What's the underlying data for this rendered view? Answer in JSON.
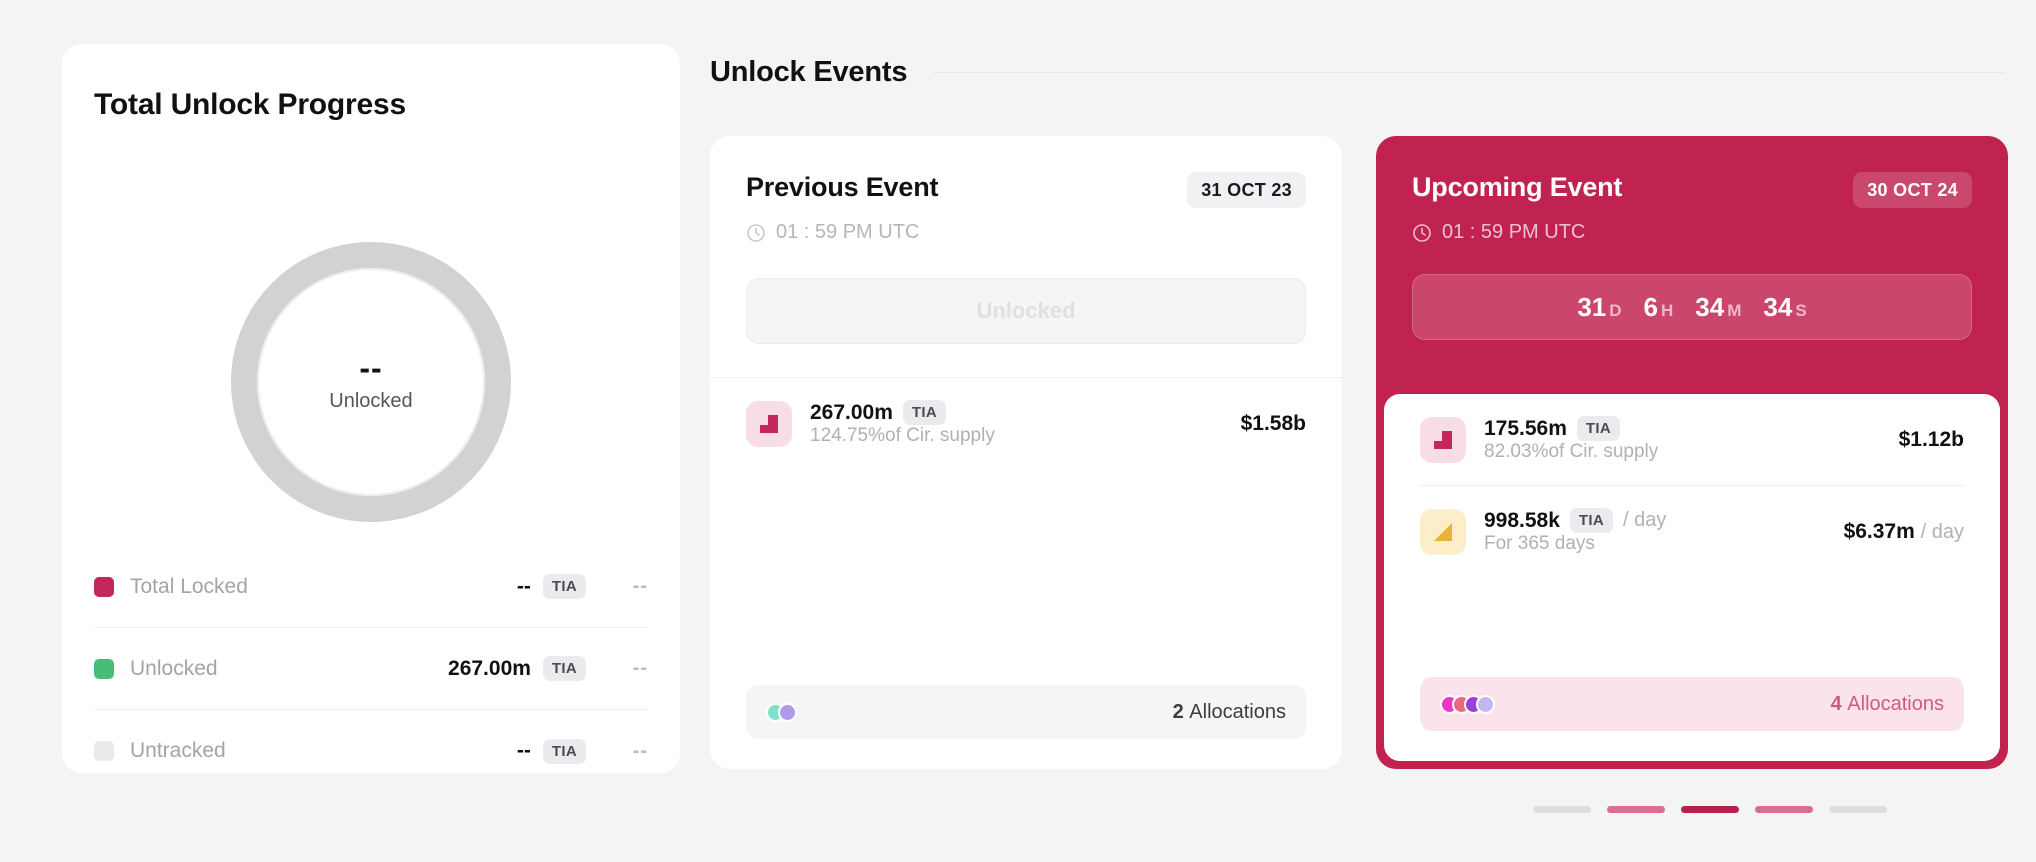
{
  "left_panel": {
    "title": "Total Unlock Progress",
    "donut": {
      "value": "--",
      "label": "Unlocked",
      "track_color": "#d2d2d2"
    },
    "legend": [
      {
        "name": "Total Locked",
        "swatch_color": "#c3275a",
        "amount": "--",
        "ticker": "TIA",
        "percent": "--"
      },
      {
        "name": "Unlocked",
        "swatch_color": "#47bd75",
        "amount": "267.00m",
        "ticker": "TIA",
        "percent": "--"
      },
      {
        "name": "Untracked",
        "swatch_color": "#ebebed",
        "amount": "--",
        "ticker": "TIA",
        "percent": "--"
      }
    ]
  },
  "events": {
    "section_title": "Unlock Events",
    "previous": {
      "title": "Previous Event",
      "date_chip": "31 OCT 23",
      "time": "01 : 59 PM UTC",
      "status_label": "Unlocked",
      "rows": [
        {
          "icon": "cliff-unlock-icon",
          "amount": "267.00m",
          "ticker": "TIA",
          "rate_suffix": "",
          "subtitle": "124.75%of Cir. supply",
          "value": "$1.58b",
          "value_suffix": ""
        }
      ],
      "allocations": {
        "count_number": "2",
        "count_label": "Allocations",
        "dot_colors": [
          "#7fe0c6",
          "#ae9ae8"
        ]
      }
    },
    "upcoming": {
      "title": "Upcoming Event",
      "date_chip": "30 OCT 24",
      "time": "01 : 59 PM UTC",
      "countdown": [
        {
          "value": "31",
          "unit": "D"
        },
        {
          "value": "6",
          "unit": "H"
        },
        {
          "value": "34",
          "unit": "M"
        },
        {
          "value": "34",
          "unit": "S"
        }
      ],
      "rows": [
        {
          "icon": "cliff-unlock-icon",
          "amount": "175.56m",
          "ticker": "TIA",
          "rate_suffix": "",
          "subtitle": "82.03%of Cir. supply",
          "value": "$1.12b",
          "value_suffix": ""
        },
        {
          "icon": "linear-vesting-icon",
          "amount": "998.58k",
          "ticker": "TIA",
          "rate_suffix": "/ day",
          "subtitle": "For 365 days",
          "value": "$6.37m",
          "value_suffix": "/ day"
        }
      ],
      "allocations": {
        "count_number": "4",
        "count_label": "Allocations",
        "dot_colors": [
          "#ec36c7",
          "#e8697f",
          "#9a3fd8",
          "#c3b6ee"
        ]
      },
      "accent_color": "#c0234f"
    }
  },
  "pagination": {
    "bars": [
      "#dedee0",
      "#d96f8f",
      "#b81f4b",
      "#d96f8f",
      "#dedee0"
    ]
  }
}
